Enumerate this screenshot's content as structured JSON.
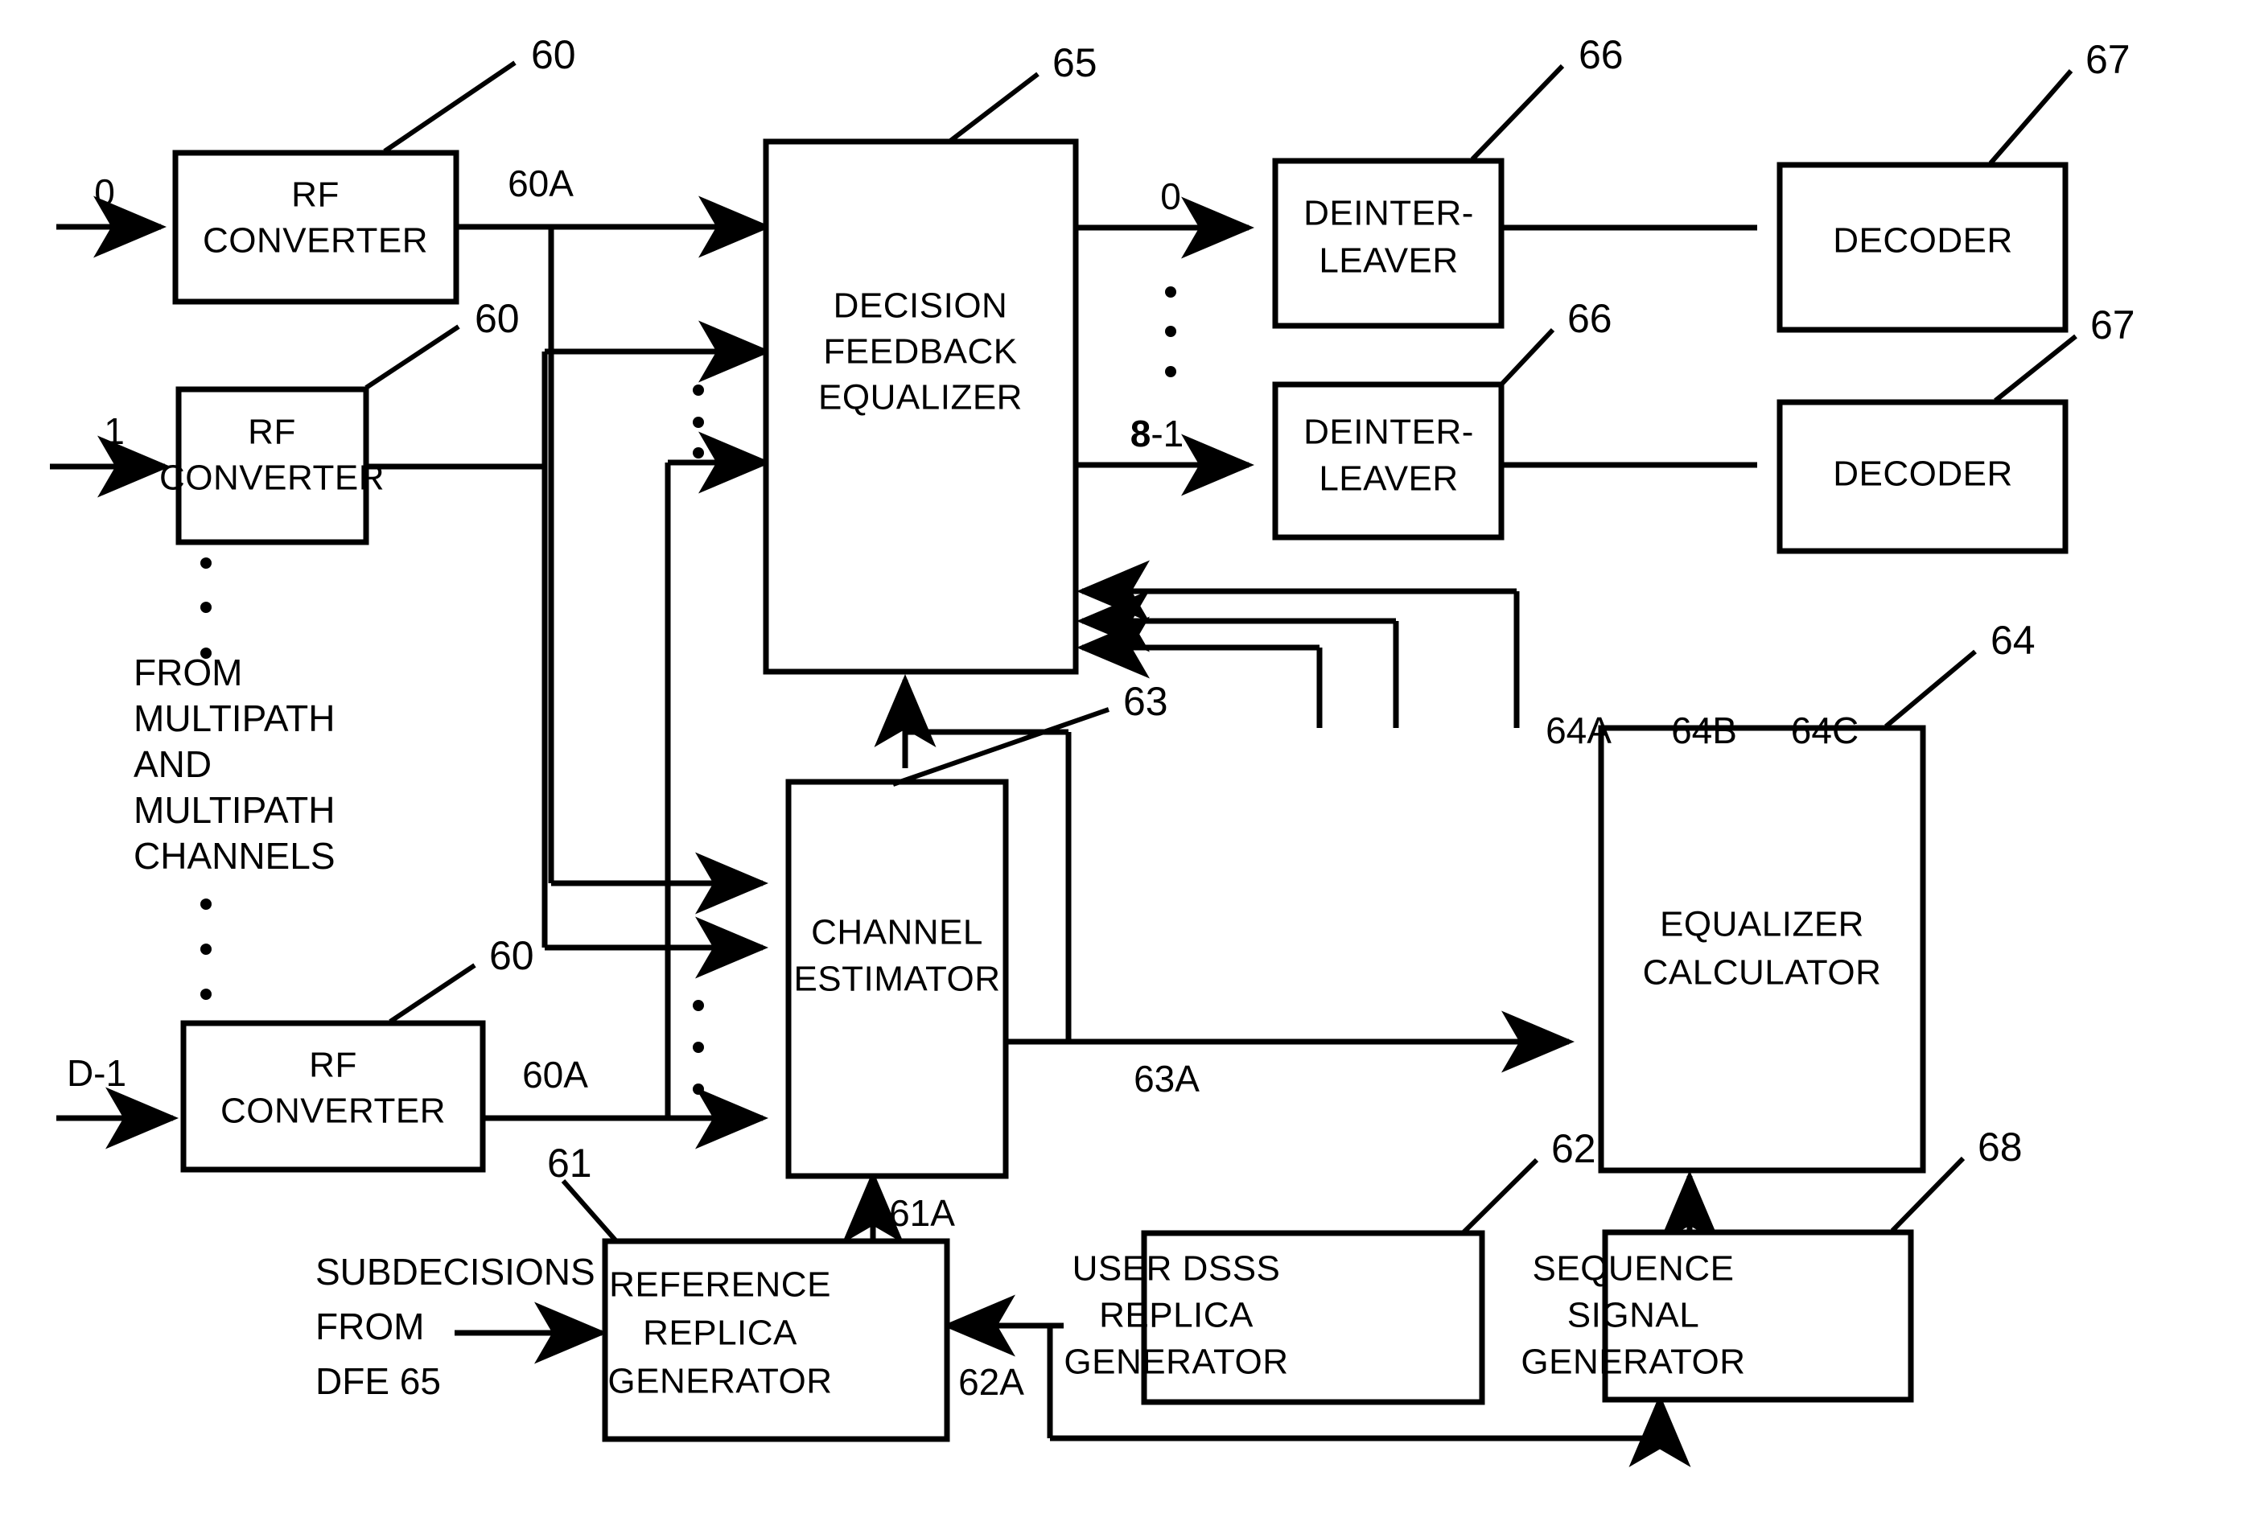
{
  "figure": {
    "kind": "patent-block-diagram",
    "description": "Receiver block diagram with RF converters, decision feedback equalizer, deinterleavers, decoders, channel estimator, equalizer calculator and replica generators"
  },
  "blocks": {
    "rf_converter_0": {
      "line1": "RF",
      "line2": "CONVERTER",
      "ref": "60",
      "output_label": "60A",
      "input_label": "0"
    },
    "rf_converter_1": {
      "line1": "RF",
      "line2": "CONVERTER",
      "ref": "60",
      "input_label": "1"
    },
    "rf_converter_d": {
      "line1": "RF",
      "line2": "CONVERTER",
      "ref": "60",
      "output_label": "60A",
      "input_label": "D-1"
    },
    "dfe": {
      "line1": "DECISION",
      "line2": "FEEDBACK",
      "line3": "EQUALIZER",
      "ref": "65"
    },
    "deinterleaver_top": {
      "line1": "DEINTER-",
      "line2": "LEAVER",
      "ref": "66"
    },
    "deinterleaver_bottom": {
      "line1": "DEINTER-",
      "line2": "LEAVER",
      "ref": "66"
    },
    "decoder_top": {
      "label": "DECODER",
      "ref": "67"
    },
    "decoder_bottom": {
      "label": "DECODER",
      "ref": "67"
    },
    "channel_estimator": {
      "line1": "CHANNEL",
      "line2": "ESTIMATOR",
      "ref": "63",
      "output_label": "63A"
    },
    "equalizer_calculator": {
      "line1": "EQUALIZER",
      "line2": "CALCULATOR",
      "ref": "64",
      "port_a": "64A",
      "port_b": "64B",
      "port_c": "64C"
    },
    "reference_replica_generator": {
      "line1": "REFERENCE",
      "line2": "REPLICA",
      "line3": "GENERATOR",
      "ref": "61",
      "output_label": "61A"
    },
    "user_dsss_replica_generator": {
      "line1": "USER DSSS",
      "line2": "REPLICA",
      "line3": "GENERATOR",
      "ref": "62",
      "output_label": "62A"
    },
    "sequence_signal_generator": {
      "line1": "SEQUENCE",
      "line2": "SIGNAL",
      "line3": "GENERATOR",
      "ref": "68"
    }
  },
  "annotations": {
    "from_multipath": {
      "line1": "FROM",
      "line2": "MULTIPATH",
      "line3": "AND",
      "line4": "MULTIPATH",
      "line5": "CHANNELS"
    },
    "subdecisions": {
      "line1": "SUBDECISIONS",
      "line2": "FROM",
      "line3": "DFE 65"
    },
    "dfe_out_top": "0",
    "dfe_out_bottom_bold": "8",
    "dfe_out_bottom_rest": "-1"
  },
  "colors": {
    "ink": "#000000",
    "paper": "#ffffff"
  }
}
